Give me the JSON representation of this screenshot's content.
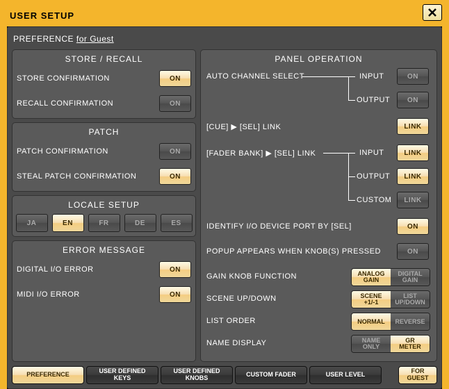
{
  "window": {
    "title": "USER SETUP"
  },
  "preference_label": "PREFERENCE",
  "preference_for": "for Guest",
  "store_recall": {
    "title": "STORE / RECALL",
    "store_label": "STORE CONFIRMATION",
    "store_btn": "ON",
    "recall_label": "RECALL CONFIRMATION",
    "recall_btn": "ON"
  },
  "patch": {
    "title": "PATCH",
    "patch_label": "PATCH CONFIRMATION",
    "patch_btn": "ON",
    "steal_label": "STEAL PATCH CONFIRMATION",
    "steal_btn": "ON"
  },
  "locale": {
    "title": "LOCALE SETUP",
    "langs": [
      "JA",
      "EN",
      "FR",
      "DE",
      "ES"
    ],
    "selected": "EN"
  },
  "error": {
    "title": "ERROR MESSAGE",
    "digital_label": "DIGITAL I/O ERROR",
    "digital_btn": "ON",
    "midi_label": "MIDI I/O ERROR",
    "midi_btn": "ON"
  },
  "panel": {
    "title": "PANEL OPERATION",
    "auto_ch": "AUTO CHANNEL SELECT",
    "input": "INPUT",
    "output": "OUTPUT",
    "custom": "CUSTOM",
    "on": "ON",
    "link": "LINK",
    "cue_sel": "[CUE]  ▶  [SEL] LINK",
    "fader_sel": "[FADER BANK]  ▶  [SEL] LINK",
    "identify": "IDENTIFY I/O DEVICE PORT BY [SEL]",
    "popup": "POPUP APPEARS WHEN KNOB(S) PRESSED",
    "gain_knob": "GAIN KNOB FUNCTION",
    "gain_opts": {
      "a1": "ANALOG",
      "a2": "GAIN",
      "b1": "DIGITAL",
      "b2": "GAIN"
    },
    "scene_ud": "SCENE UP/DOWN",
    "scene_opts": {
      "a1": "SCENE",
      "a2": "+1/-1",
      "b1": "LIST",
      "b2": "UP/DOWN"
    },
    "list_order": "LIST ORDER",
    "list_opts": {
      "a": "NORMAL",
      "b": "REVERSE"
    },
    "name_disp": "NAME DISPLAY",
    "name_opts": {
      "a1": "NAME",
      "a2": "ONLY",
      "b1": "GR",
      "b2": "METER"
    }
  },
  "tabs": {
    "preference": "PREFERENCE",
    "udk1": "USER DEFINED",
    "udk2": "KEYS",
    "udn1": "USER DEFINED",
    "udn2": "KNOBS",
    "custom_fader": "CUSTOM FADER",
    "user_level": "USER LEVEL",
    "fg1": "FOR",
    "fg2": "GUEST"
  }
}
